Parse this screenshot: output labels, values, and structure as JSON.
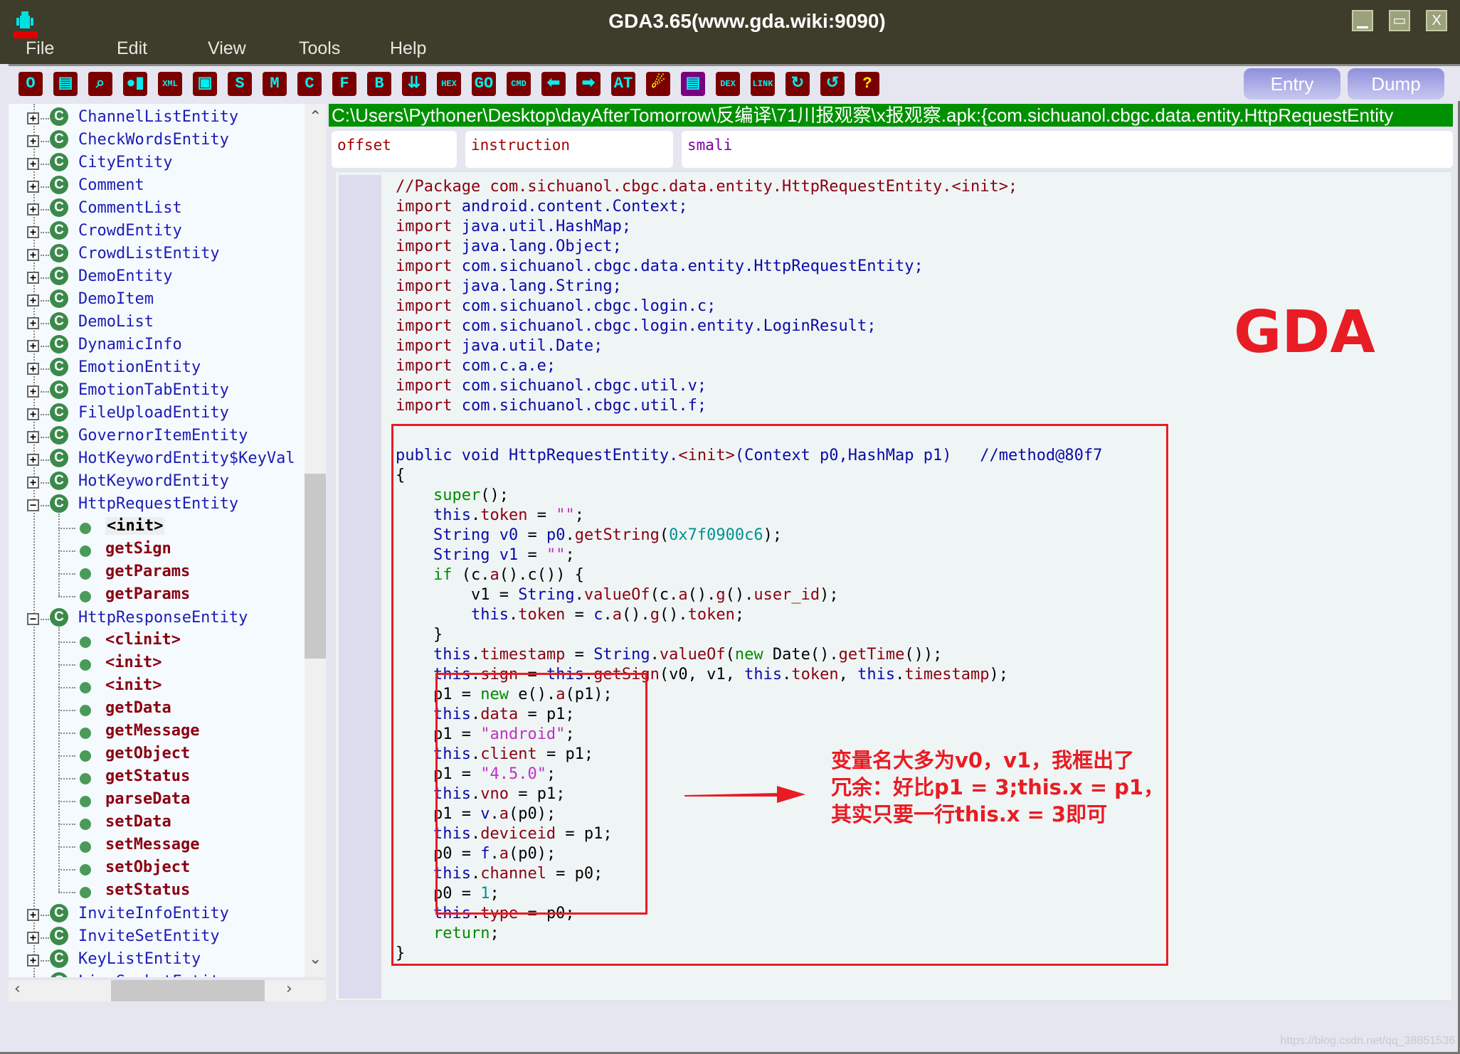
{
  "window": {
    "title": "GDA3.65(www.gda.wiki:9090)",
    "controls": {
      "minimize": "▁",
      "maximize": "▭",
      "close": "X"
    }
  },
  "menu": [
    "File",
    "Edit",
    "View",
    "Tools",
    "Help"
  ],
  "toolbar": {
    "icons": [
      {
        "name": "open-icon",
        "glyph": "O"
      },
      {
        "name": "save-icon",
        "glyph": "▤"
      },
      {
        "name": "search-icon",
        "glyph": "⌕"
      },
      {
        "name": "toggle-icon",
        "glyph": "●▮"
      },
      {
        "name": "xml-icon",
        "glyph": "XML"
      },
      {
        "name": "android-icon",
        "glyph": "▣"
      },
      {
        "name": "strings-icon",
        "glyph": "S"
      },
      {
        "name": "methods-icon",
        "glyph": "M"
      },
      {
        "name": "classes-icon",
        "glyph": "C"
      },
      {
        "name": "fields-icon",
        "glyph": "F"
      },
      {
        "name": "bookmark-icon",
        "glyph": "B"
      },
      {
        "name": "download-icon",
        "glyph": "⇊"
      },
      {
        "name": "hex-icon",
        "glyph": "HEX"
      },
      {
        "name": "goto-icon",
        "glyph": "GO"
      },
      {
        "name": "cmd-icon",
        "glyph": "CMD"
      },
      {
        "name": "back-arrow-icon",
        "glyph": "⬅"
      },
      {
        "name": "forward-arrow-icon",
        "glyph": "➡"
      },
      {
        "name": "at-icon",
        "glyph": "AT"
      },
      {
        "name": "malware-scan-icon",
        "glyph": "☄"
      },
      {
        "name": "certificate-icon",
        "glyph": "▤"
      },
      {
        "name": "dex-icon",
        "glyph": "DEX"
      },
      {
        "name": "link-icon",
        "glyph": "LINK"
      },
      {
        "name": "refresh-stop-icon",
        "glyph": "↻"
      },
      {
        "name": "undo-icon",
        "glyph": "↺"
      },
      {
        "name": "help-icon",
        "glyph": "?"
      }
    ],
    "entry_label": "Entry",
    "dump_label": "Dump"
  },
  "tree": {
    "rows": [
      {
        "type": "class",
        "label": "ChannelListEntity",
        "state": "collapsed"
      },
      {
        "type": "class",
        "label": "CheckWordsEntity",
        "state": "collapsed"
      },
      {
        "type": "class",
        "label": "CityEntity",
        "state": "collapsed"
      },
      {
        "type": "class",
        "label": "Comment",
        "state": "collapsed"
      },
      {
        "type": "class",
        "label": "CommentList",
        "state": "collapsed"
      },
      {
        "type": "class",
        "label": "CrowdEntity",
        "state": "collapsed"
      },
      {
        "type": "class",
        "label": "CrowdListEntity",
        "state": "collapsed"
      },
      {
        "type": "class",
        "label": "DemoEntity",
        "state": "collapsed"
      },
      {
        "type": "class",
        "label": "DemoItem",
        "state": "collapsed"
      },
      {
        "type": "class",
        "label": "DemoList",
        "state": "collapsed"
      },
      {
        "type": "class",
        "label": "DynamicInfo",
        "state": "collapsed"
      },
      {
        "type": "class",
        "label": "EmotionEntity",
        "state": "collapsed"
      },
      {
        "type": "class",
        "label": "EmotionTabEntity",
        "state": "collapsed"
      },
      {
        "type": "class",
        "label": "FileUploadEntity",
        "state": "collapsed"
      },
      {
        "type": "class",
        "label": "GovernorItemEntity",
        "state": "collapsed"
      },
      {
        "type": "class",
        "label": "HotKeywordEntity$KeyVal",
        "state": "collapsed"
      },
      {
        "type": "class",
        "label": "HotKeywordEntity",
        "state": "collapsed"
      },
      {
        "type": "class",
        "label": "HttpRequestEntity",
        "state": "expanded"
      },
      {
        "type": "method",
        "label": "<init>",
        "selected": true
      },
      {
        "type": "method",
        "label": "getSign"
      },
      {
        "type": "method",
        "label": "getParams"
      },
      {
        "type": "method",
        "label": "getParams",
        "last": true
      },
      {
        "type": "class",
        "label": "HttpResponseEntity",
        "state": "expanded"
      },
      {
        "type": "method",
        "label": "<clinit>"
      },
      {
        "type": "method",
        "label": "<init>"
      },
      {
        "type": "method",
        "label": "<init>"
      },
      {
        "type": "method",
        "label": "getData"
      },
      {
        "type": "method",
        "label": "getMessage"
      },
      {
        "type": "method",
        "label": "getObject"
      },
      {
        "type": "method",
        "label": "getStatus"
      },
      {
        "type": "method",
        "label": "parseData"
      },
      {
        "type": "method",
        "label": "setData"
      },
      {
        "type": "method",
        "label": "setMessage"
      },
      {
        "type": "method",
        "label": "setObject"
      },
      {
        "type": "method",
        "label": "setStatus",
        "last": true
      },
      {
        "type": "class",
        "label": "InviteInfoEntity",
        "state": "collapsed"
      },
      {
        "type": "class",
        "label": "InviteSetEntity",
        "state": "collapsed"
      },
      {
        "type": "class",
        "label": "KeyListEntity",
        "state": "collapsed"
      },
      {
        "type": "class",
        "label": "LiveSocketEntity",
        "state": "collapsed"
      }
    ]
  },
  "path_bar": "C:\\Users\\Pythoner\\Desktop\\dayAfterTomorrow\\反编译\\71川报观察\\x报观察.apk:{com.sichuanol.cbgc.data.entity.HttpRequestEntity",
  "column_headers": {
    "offset": "offset",
    "instruction": "instruction",
    "smali": "smali"
  },
  "code": {
    "lines": [
      [
        [
          "cm",
          "//Package com.sichuanol.cbgc.data.entity.HttpRequestEntity.<init>;"
        ]
      ],
      [
        [
          "fn",
          "import "
        ],
        [
          "kw",
          "android.content.Context;"
        ]
      ],
      [
        [
          "fn",
          "import "
        ],
        [
          "kw",
          "java.util.HashMap;"
        ]
      ],
      [
        [
          "fn",
          "import "
        ],
        [
          "kw",
          "java.lang.Object;"
        ]
      ],
      [
        [
          "fn",
          "import "
        ],
        [
          "kw",
          "com.sichuanol.cbgc.data.entity.HttpRequestEntity;"
        ]
      ],
      [
        [
          "fn",
          "import "
        ],
        [
          "kw",
          "java.lang.String;"
        ]
      ],
      [
        [
          "fn",
          "import "
        ],
        [
          "kw",
          "com.sichuanol.cbgc.login.c;"
        ]
      ],
      [
        [
          "fn",
          "import "
        ],
        [
          "kw",
          "com.sichuanol.cbgc.login.entity.LoginResult;"
        ]
      ],
      [
        [
          "fn",
          "import "
        ],
        [
          "kw",
          "java.util.Date;"
        ]
      ],
      [
        [
          "fn",
          "import "
        ],
        [
          "kw",
          "com.c.a.e;"
        ]
      ],
      [
        [
          "fn",
          "import "
        ],
        [
          "kw",
          "com.sichuanol.cbgc.util.v;"
        ]
      ],
      [
        [
          "fn",
          "import "
        ],
        [
          "kw",
          "com.sichuanol.cbgc.util.f;"
        ]
      ],
      [],
      [
        [
          "kw",
          "public void HttpRequestEntity."
        ],
        [
          "fn",
          "<init>"
        ],
        [
          "kw",
          "(Context p0,HashMap p1)   //method@80f7"
        ]
      ],
      [
        [
          "",
          "{"
        ]
      ],
      [
        [
          "",
          "    "
        ],
        [
          "gr",
          "super"
        ],
        [
          "",
          "();"
        ]
      ],
      [
        [
          "",
          "    "
        ],
        [
          "kw",
          "this"
        ],
        [
          "",
          "."
        ],
        [
          "fn",
          "token"
        ],
        [
          "",
          " = "
        ],
        [
          "st",
          "\"\""
        ],
        [
          "",
          ";"
        ]
      ],
      [
        [
          "",
          "    "
        ],
        [
          "kw",
          "String v0"
        ],
        [
          "",
          " = "
        ],
        [
          "kw",
          "p0"
        ],
        [
          "",
          "."
        ],
        [
          "fn",
          "getString"
        ],
        [
          "",
          "("
        ],
        [
          "nm",
          "0x7f0900c6"
        ],
        [
          "",
          ");"
        ]
      ],
      [
        [
          "",
          "    "
        ],
        [
          "kw",
          "String v1"
        ],
        [
          "",
          " = "
        ],
        [
          "st",
          "\"\""
        ],
        [
          "",
          ";"
        ]
      ],
      [
        [
          "",
          "    "
        ],
        [
          "gr",
          "if"
        ],
        [
          "",
          " (c."
        ],
        [
          "fn",
          "a"
        ],
        [
          "",
          "().c()) {"
        ]
      ],
      [
        [
          "",
          "        v1 = "
        ],
        [
          "kw",
          "String"
        ],
        [
          "",
          "."
        ],
        [
          "fn",
          "valueOf"
        ],
        [
          "",
          "(c."
        ],
        [
          "fn",
          "a"
        ],
        [
          "",
          "()."
        ],
        [
          "fn",
          "g"
        ],
        [
          "",
          "()."
        ],
        [
          "fn",
          "user_id"
        ],
        [
          "",
          ");"
        ]
      ],
      [
        [
          "",
          "        "
        ],
        [
          "kw",
          "this"
        ],
        [
          "",
          "."
        ],
        [
          "fn",
          "token"
        ],
        [
          "",
          " = "
        ],
        [
          "kw",
          "c"
        ],
        [
          "",
          "."
        ],
        [
          "fn",
          "a"
        ],
        [
          "",
          "()."
        ],
        [
          "fn",
          "g"
        ],
        [
          "",
          "()."
        ],
        [
          "fn",
          "token"
        ],
        [
          "",
          ";"
        ]
      ],
      [
        [
          "",
          "    }"
        ]
      ],
      [
        [
          "",
          "    "
        ],
        [
          "kw",
          "this"
        ],
        [
          "",
          "."
        ],
        [
          "fn",
          "timestamp"
        ],
        [
          "",
          " = "
        ],
        [
          "kw",
          "String"
        ],
        [
          "",
          "."
        ],
        [
          "fn",
          "valueOf"
        ],
        [
          "",
          "("
        ],
        [
          "gr",
          "new"
        ],
        [
          "",
          " Date()."
        ],
        [
          "fn",
          "getTime"
        ],
        [
          "",
          "());"
        ]
      ],
      [
        [
          "",
          "    "
        ],
        [
          "kw",
          "this"
        ],
        [
          "",
          "."
        ],
        [
          "fn",
          "sign"
        ],
        [
          "",
          " = "
        ],
        [
          "kw",
          "this"
        ],
        [
          "",
          "."
        ],
        [
          "fn",
          "getSign"
        ],
        [
          "",
          "(v0, v1, "
        ],
        [
          "kw",
          "this"
        ],
        [
          "",
          "."
        ],
        [
          "fn",
          "token"
        ],
        [
          "",
          ", "
        ],
        [
          "kw",
          "this"
        ],
        [
          "",
          "."
        ],
        [
          "fn",
          "timestamp"
        ],
        [
          "",
          ");"
        ]
      ],
      [
        [
          "",
          "    p1 = "
        ],
        [
          "gr",
          "new"
        ],
        [
          "",
          " e()."
        ],
        [
          "fn",
          "a"
        ],
        [
          "",
          "(p1);"
        ]
      ],
      [
        [
          "",
          "    "
        ],
        [
          "kw",
          "this"
        ],
        [
          "",
          "."
        ],
        [
          "fn",
          "data"
        ],
        [
          "",
          " = p1;"
        ]
      ],
      [
        [
          "",
          "    p1 = "
        ],
        [
          "st",
          "\"android\""
        ],
        [
          "",
          ";"
        ]
      ],
      [
        [
          "",
          "    "
        ],
        [
          "kw",
          "this"
        ],
        [
          "",
          "."
        ],
        [
          "fn",
          "client"
        ],
        [
          "",
          " = p1;"
        ]
      ],
      [
        [
          "",
          "    p1 = "
        ],
        [
          "st",
          "\"4.5.0\""
        ],
        [
          "",
          ";"
        ]
      ],
      [
        [
          "",
          "    "
        ],
        [
          "kw",
          "this"
        ],
        [
          "",
          "."
        ],
        [
          "fn",
          "vno"
        ],
        [
          "",
          " = p1;"
        ]
      ],
      [
        [
          "",
          "    p1 = "
        ],
        [
          "kw",
          "v"
        ],
        [
          "",
          "."
        ],
        [
          "fn",
          "a"
        ],
        [
          "",
          "(p0);"
        ]
      ],
      [
        [
          "",
          "    "
        ],
        [
          "kw",
          "this"
        ],
        [
          "",
          "."
        ],
        [
          "fn",
          "deviceid"
        ],
        [
          "",
          " = p1;"
        ]
      ],
      [
        [
          "",
          "    p0 = "
        ],
        [
          "kw",
          "f"
        ],
        [
          "",
          "."
        ],
        [
          "fn",
          "a"
        ],
        [
          "",
          "(p0);"
        ]
      ],
      [
        [
          "",
          "    "
        ],
        [
          "kw",
          "this"
        ],
        [
          "",
          "."
        ],
        [
          "fn",
          "channel"
        ],
        [
          "",
          " = p0;"
        ]
      ],
      [
        [
          "",
          "    p0 = "
        ],
        [
          "nm",
          "1"
        ],
        [
          "",
          ";"
        ]
      ],
      [
        [
          "",
          "    "
        ],
        [
          "kw",
          "this"
        ],
        [
          "",
          "."
        ],
        [
          "fn",
          "type"
        ],
        [
          "",
          " = p0;"
        ]
      ],
      [
        [
          "",
          "    "
        ],
        [
          "gr",
          "return"
        ],
        [
          "",
          ";"
        ]
      ],
      [
        [
          "",
          "}"
        ]
      ]
    ]
  },
  "annotation": {
    "gda_label": "GDA",
    "note_lines": [
      "变量名大多为v0，v1，我框出了",
      "冗余：好比p1 = 3;this.x = p1，",
      "其实只要一行this.x = 3即可"
    ]
  },
  "watermark": "https://blog.csdn.net/qq_38851536"
}
